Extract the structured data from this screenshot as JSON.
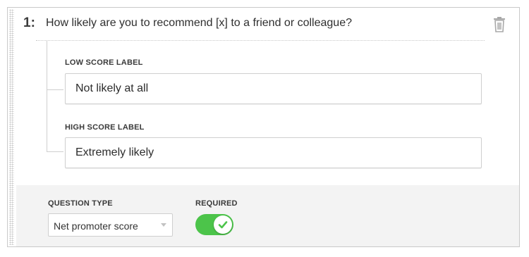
{
  "question": {
    "number": "1:",
    "text": "How likely are you to recommend [x] to a friend or colleague?"
  },
  "low_score": {
    "label": "LOW SCORE LABEL",
    "value": "Not likely at all"
  },
  "high_score": {
    "label": "HIGH SCORE LABEL",
    "value": "Extremely likely"
  },
  "question_type": {
    "label": "QUESTION TYPE",
    "selected": "Net promoter score"
  },
  "required": {
    "label": "REQUIRED",
    "checked": true
  },
  "icons": {
    "delete": "trash-icon",
    "drag": "drag-handle-icon",
    "toggle_check": "checkmark-icon",
    "select_caret": "caret-down-icon"
  },
  "colors": {
    "toggle_on": "#4cc44a",
    "footer_background": "#f3f3f3",
    "border": "#c9c9c9"
  }
}
